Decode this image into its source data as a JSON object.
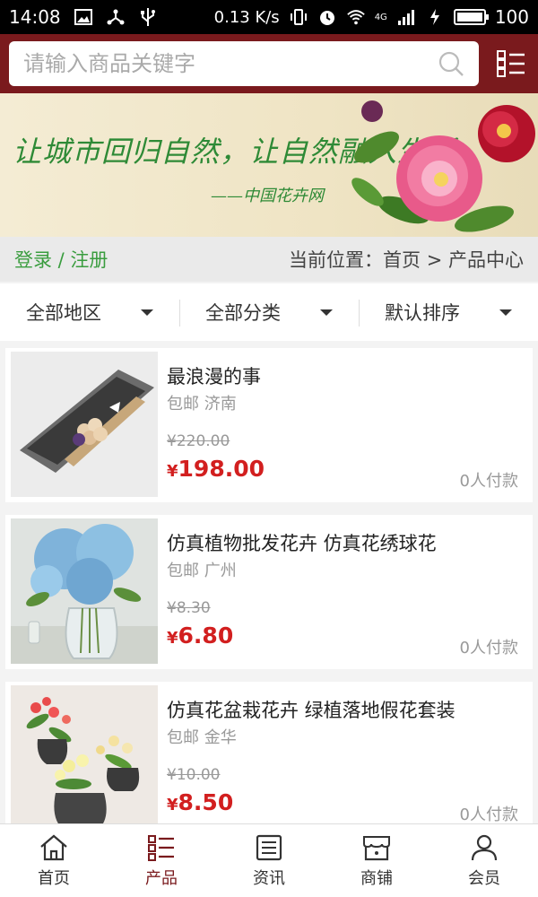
{
  "status_bar": {
    "time": "14:08",
    "speed": "0.13 K/s",
    "signal_label": "4G",
    "battery": "100"
  },
  "search": {
    "placeholder": "请输入商品关键字"
  },
  "banner": {
    "slogan": "让城市回归自然，让自然融入生活",
    "signature": "——中国花卉网"
  },
  "location_bar": {
    "login_text": "登录 / 注册",
    "breadcrumb": "当前位置：首页 > 产品中心"
  },
  "filters": [
    {
      "label": "全部地区"
    },
    {
      "label": "全部分类"
    },
    {
      "label": "默认排序"
    }
  ],
  "products": [
    {
      "name": "最浪漫的事",
      "shipping": "包邮 济南",
      "old_price": "¥220.00",
      "price": "198.00",
      "currency": "¥",
      "sold": "0人付款",
      "image": "rose-gift-box"
    },
    {
      "name": "仿真植物批发花卉 仿真花绣球花",
      "shipping": "包邮 广州",
      "old_price": "¥8.30",
      "price": "6.80",
      "currency": "¥",
      "sold": "0人付款",
      "image": "blue-hydrangea-vase"
    },
    {
      "name": "仿真花盆栽花卉 绿植落地假花套装",
      "shipping": "包邮 金华",
      "old_price": "¥10.00",
      "price": "8.50",
      "currency": "¥",
      "sold": "0人付款",
      "image": "potted-artificial-flowers"
    }
  ],
  "tabbar": [
    {
      "label": "首页",
      "icon": "home-icon"
    },
    {
      "label": "产品",
      "icon": "list-icon",
      "active": true
    },
    {
      "label": "资讯",
      "icon": "news-icon"
    },
    {
      "label": "商铺",
      "icon": "store-icon"
    },
    {
      "label": "会员",
      "icon": "user-icon"
    }
  ],
  "colors": {
    "brand": "#7a1a1d",
    "price": "#d21f1f",
    "login": "#3a9d3f",
    "slogan": "#2e8a36"
  }
}
